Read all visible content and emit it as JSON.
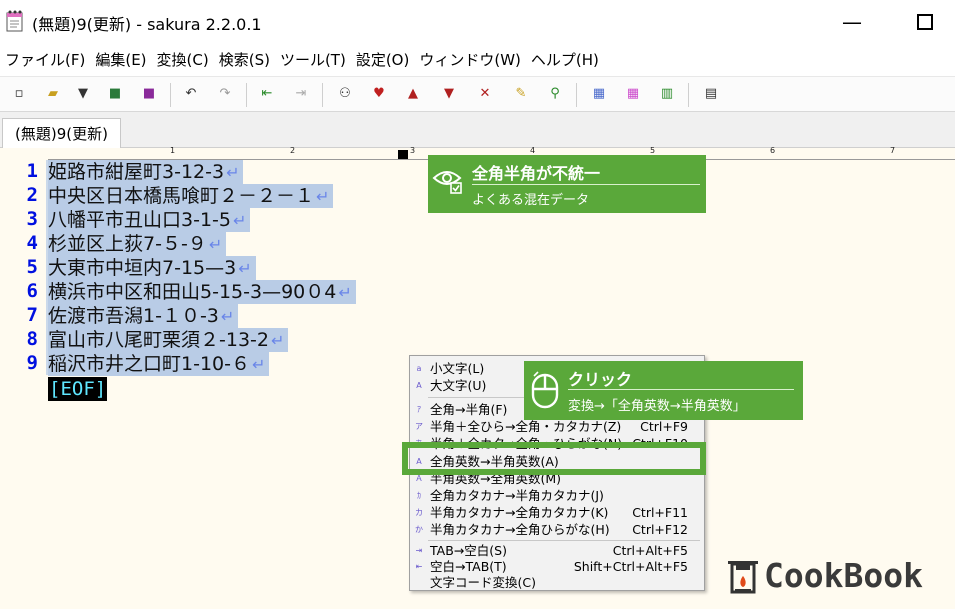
{
  "window": {
    "title": "(無題)9(更新) - sakura 2.2.0.1",
    "minimize_glyph": "—",
    "maximize_glyph": "□"
  },
  "menubar": [
    "ファイル(F)",
    "編集(E)",
    "変換(C)",
    "検索(S)",
    "ツール(T)",
    "設定(O)",
    "ウィンドウ(W)",
    "ヘルプ(H)"
  ],
  "toolbar": {
    "icons": [
      "new-file-icon",
      "open-file-icon",
      "dropdown-arrow-icon",
      "save-icon",
      "save-all-icon",
      "undo-icon",
      "redo-icon",
      "jump-back-icon",
      "jump-forward-icon",
      "find-icon",
      "find-heart-icon",
      "find-prev-icon",
      "find-next-icon",
      "clear-find-icon",
      "find-mark-icon",
      "grep-icon",
      "compare-icon",
      "outline-icon",
      "split-icon",
      "settings-icon"
    ]
  },
  "tab": {
    "label": "(無題)9(更新)"
  },
  "ruler": {
    "labels": [
      "1",
      "2",
      "3",
      "4",
      "5",
      "6",
      "7"
    ]
  },
  "editor": {
    "eol_mark": "↵",
    "eof_mark": "[EOF]",
    "lines": [
      {
        "no": "1",
        "text": "姫路市紺屋町3-12-3"
      },
      {
        "no": "2",
        "text": "中央区日本橋馬喰町２－２－１"
      },
      {
        "no": "3",
        "text": "八幡平市丑山口3-1-5"
      },
      {
        "no": "4",
        "text": "杉並区上荻7-５-９"
      },
      {
        "no": "5",
        "text": "大東市中垣内7-15—3"
      },
      {
        "no": "6",
        "text": "横浜市中区和田山5-15-3—90０4"
      },
      {
        "no": "7",
        "text": "佐渡市吾潟1-１０-3"
      },
      {
        "no": "8",
        "text": "富山市八尾町栗須２-13-2"
      },
      {
        "no": "9",
        "text": "稲沢市井之口町1-10-６"
      }
    ]
  },
  "callouts": {
    "issue": {
      "title": "全角半角が不統一",
      "subtitle": "よくある混在データ",
      "icon": "eye-check-icon"
    },
    "click": {
      "title": "クリック",
      "subtitle": "変換→「全角英数→半角英数」",
      "icon": "mouse-icon"
    }
  },
  "context_menu": {
    "items": [
      {
        "label": "小文字(L)",
        "key": ""
      },
      {
        "label": "大文字(U)",
        "key": ""
      },
      {
        "label": "全角→半角(F)",
        "key": ""
      },
      {
        "label": "半角＋全ひら→全角・カタカナ(Z)",
        "key": "Ctrl+F9"
      },
      {
        "label": "半角＋全カタ→全角・ひらがな(N)",
        "key": "Ctrl+F10"
      },
      {
        "label": "全角英数→半角英数(A)",
        "key": ""
      },
      {
        "label": "半角英数→全角英数(M)",
        "key": ""
      },
      {
        "label": "全角カタカナ→半角カタカナ(J)",
        "key": ""
      },
      {
        "label": "半角カタカナ→全角カタカナ(K)",
        "key": "Ctrl+F11"
      },
      {
        "label": "半角カタカナ→全角ひらがな(H)",
        "key": "Ctrl+F12"
      },
      {
        "label": "TAB→空白(S)",
        "key": "Ctrl+Alt+F5"
      },
      {
        "label": "空白→TAB(T)",
        "key": "Shift+Ctrl+Alt+F5"
      },
      {
        "label": "文字コード変換(C)",
        "key": ""
      }
    ]
  },
  "branding": {
    "logo_text": "CookBook",
    "colors": {
      "callout_green": "#5aa83a",
      "line_number_blue": "#0010e0"
    }
  }
}
